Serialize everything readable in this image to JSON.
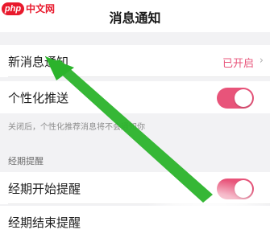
{
  "header": {
    "title": "消息通知"
  },
  "watermark": {
    "logo": "php",
    "text": "中文网"
  },
  "rows": {
    "new_message": {
      "label": "新消息通知",
      "value": "已开启",
      "chevron": "›"
    },
    "personalized_push": {
      "label": "个性化推送",
      "enabled": true
    }
  },
  "hint": "关闭后，个性化推荐消息将不会通知你",
  "period_section": {
    "title": "经期提醒",
    "rows": [
      {
        "label": "经期开始提醒",
        "enabled": true
      },
      {
        "label": "经期结束提醒"
      }
    ]
  },
  "annotation": {
    "arrow_icon": "green-arrow",
    "color": "#2bb32b"
  },
  "colors": {
    "accent": "#e8547a",
    "watermark": "#e8192c"
  }
}
